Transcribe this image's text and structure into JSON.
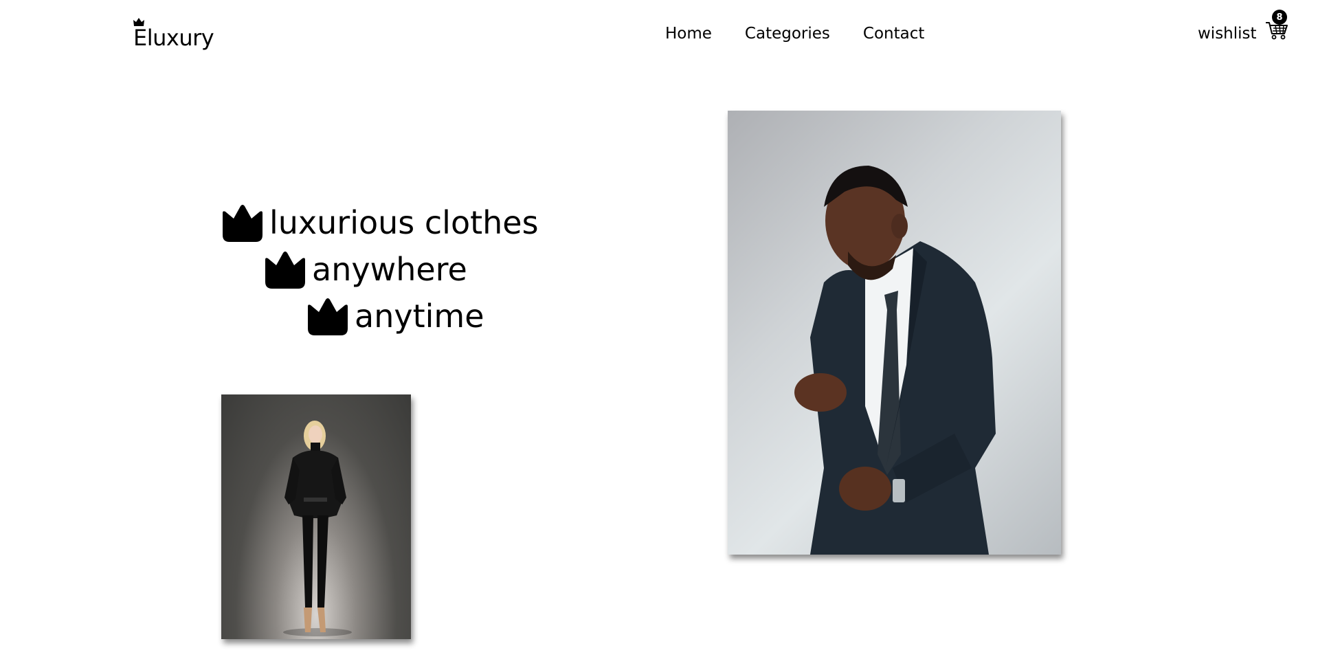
{
  "brand": {
    "name": "Eluxury"
  },
  "nav": {
    "items": [
      "Home",
      "Categories",
      "Contact"
    ]
  },
  "header": {
    "wishlist_label": "wishlist",
    "cart_count": "8"
  },
  "hero": {
    "lines": [
      "luxurious clothes",
      "anywhere",
      "anytime"
    ]
  },
  "icons": {
    "brand_crown": "crown-icon",
    "hero_bullet": "crown-icon",
    "cart": "shopping-cart-icon"
  },
  "colors": {
    "text": "#000000",
    "background": "#ffffff",
    "badge": "#000000"
  }
}
